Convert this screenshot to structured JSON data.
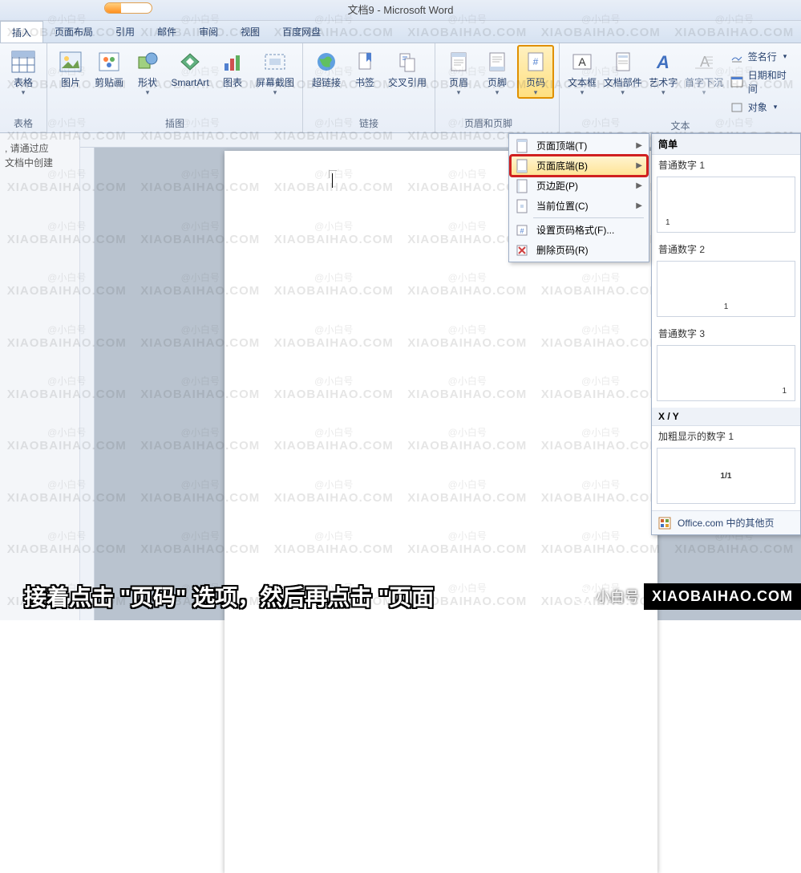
{
  "title": "文档9 - Microsoft Word",
  "tabs": [
    "插入",
    "页面布局",
    "引用",
    "邮件",
    "审阅",
    "视图",
    "百度网盘"
  ],
  "activeTab": 0,
  "ribbon": {
    "group_tables": {
      "label": "表格",
      "btn_table": "表格"
    },
    "group_illustrations": {
      "label": "插图",
      "btn_picture": "图片",
      "btn_clipart": "剪贴画",
      "btn_shapes": "形状",
      "btn_smartart": "SmartArt",
      "btn_chart": "图表",
      "btn_screenshot": "屏幕截图"
    },
    "group_links": {
      "label": "链接",
      "btn_hyperlink": "超链接",
      "btn_bookmark": "书签",
      "btn_crossref": "交叉引用"
    },
    "group_headerfooter": {
      "label": "页眉和页脚",
      "btn_header": "页眉",
      "btn_footer": "页脚",
      "btn_pagenum": "页码"
    },
    "group_text": {
      "label": "文本",
      "btn_textbox": "文本框",
      "btn_quickparts": "文档部件",
      "btn_wordart": "艺术字",
      "btn_dropcap": "首字下沉",
      "btn_sigline": "签名行",
      "btn_datetime": "日期和时间",
      "btn_object": "对象"
    }
  },
  "dropdown": {
    "top": "页面顶端(T)",
    "bottom": "页面底端(B)",
    "margins": "页边距(P)",
    "current": "当前位置(C)",
    "format": "设置页码格式(F)...",
    "remove": "删除页码(R)"
  },
  "gallery": {
    "section1": "简单",
    "item1": "普通数字 1",
    "item2": "普通数字 2",
    "item3": "普通数字 3",
    "section2": "X / Y",
    "item4": "加粗显示的数字 1",
    "thumb4": "1/1",
    "footer": "Office.com 中的其他页"
  },
  "nav": {
    "line1": ", 请通过应",
    "line2": "文档中创建"
  },
  "watermark": {
    "a": "@小白号",
    "b": "XIAOBAIHAO.COM"
  },
  "caption": "接着点击 \"页码\" 选项，然后再点击 \"页面",
  "brand_pill": "小白号",
  "brand_box": "XIAOBAIHAO.COM"
}
